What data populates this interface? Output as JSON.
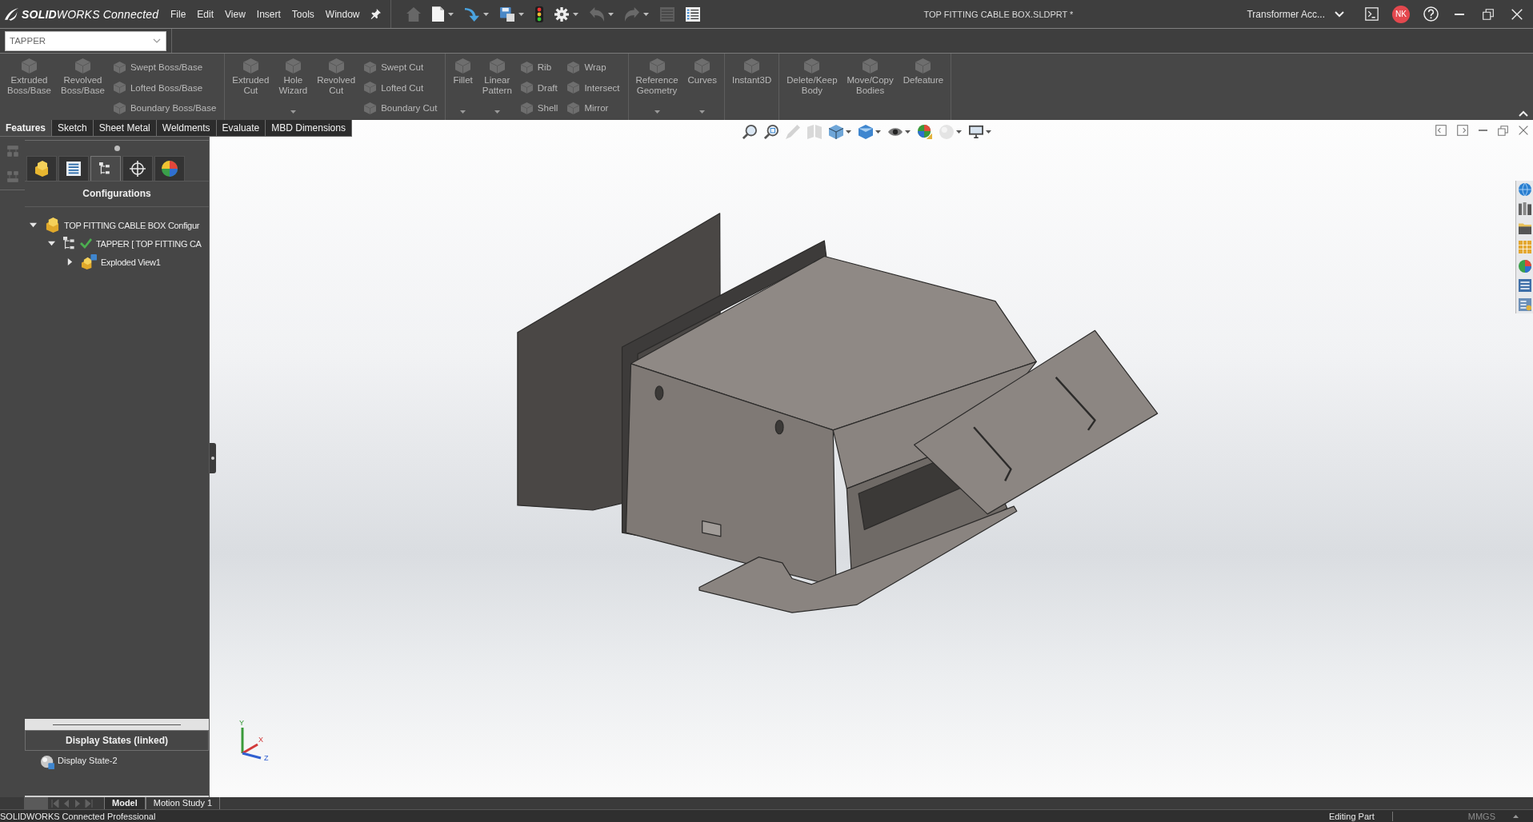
{
  "title_bar": {
    "brand": "**SOLID**WORKS Connected",
    "menu": [
      "File",
      "Edit",
      "View",
      "Insert",
      "Tools",
      "Window"
    ],
    "quick_access": [
      {
        "dropdown": false,
        "disabled": true
      },
      {
        "dropdown": true,
        "disabled": false
      },
      {
        "dropdown": true,
        "disabled": false
      },
      {
        "dropdown": true,
        "disabled": false
      },
      {
        "dropdown": false,
        "disabled": false
      },
      {
        "dropdown": true,
        "disabled": false
      },
      {
        "dropdown": true,
        "disabled": true
      },
      {
        "dropdown": true,
        "disabled": true
      },
      {
        "dropdown": false,
        "disabled": true
      },
      {
        "dropdown": false,
        "disabled": false
      }
    ],
    "document_title": "TOP FITTING CABLE BOX.SLDPRT *",
    "account": "Transformer Acc...",
    "avatar": "NK"
  },
  "configuration_selector": {
    "value": "TAPPER"
  },
  "ribbon": {
    "groups": [
      {
        "items": [
          {
            "kind": "large",
            "label": "Extruded Boss/Base",
            "dropdown": false
          },
          {
            "kind": "large",
            "label": "Revolved Boss/Base",
            "dropdown": false
          },
          {
            "kind": "column",
            "buttons": [
              "Swept Boss/Base",
              "Lofted Boss/Base",
              "Boundary Boss/Base"
            ]
          }
        ]
      },
      {
        "items": [
          {
            "kind": "large",
            "label": "Extruded Cut",
            "dropdown": false
          },
          {
            "kind": "large",
            "label": "Hole Wizard",
            "dropdown": true
          },
          {
            "kind": "large",
            "label": "Revolved Cut",
            "dropdown": false
          },
          {
            "kind": "column",
            "buttons": [
              "Swept Cut",
              "Lofted Cut",
              "Boundary Cut"
            ]
          }
        ]
      },
      {
        "items": [
          {
            "kind": "large",
            "label": "Fillet",
            "dropdown": true
          },
          {
            "kind": "large",
            "label": "Linear Pattern",
            "dropdown": true
          },
          {
            "kind": "column",
            "buttons": [
              "Rib",
              "Draft",
              "Shell"
            ]
          },
          {
            "kind": "column",
            "buttons": [
              "Wrap",
              "Intersect",
              "Mirror"
            ]
          }
        ]
      },
      {
        "items": [
          {
            "kind": "large",
            "label": "Reference Geometry",
            "dropdown": true
          },
          {
            "kind": "large",
            "label": "Curves",
            "dropdown": true
          }
        ]
      },
      {
        "items": [
          {
            "kind": "large",
            "label": "Instant3D",
            "dropdown": false
          }
        ]
      },
      {
        "items": [
          {
            "kind": "large",
            "label": "Delete/Keep Body",
            "dropdown": false
          },
          {
            "kind": "large",
            "label": "Move/Copy Bodies",
            "dropdown": false
          },
          {
            "kind": "large",
            "label": "Defeature",
            "dropdown": false
          }
        ]
      }
    ]
  },
  "command_tabs": [
    {
      "label": "Features",
      "selected": true
    },
    {
      "label": "Sketch",
      "selected": false
    },
    {
      "label": "Sheet Metal",
      "selected": false
    },
    {
      "label": "Weldments",
      "selected": false
    },
    {
      "label": "Evaluate",
      "selected": false
    },
    {
      "label": "MBD Dimensions",
      "selected": false
    }
  ],
  "manager_tabs": [
    {
      "selected": false
    },
    {
      "selected": false
    },
    {
      "selected": true
    },
    {
      "selected": false
    },
    {
      "selected": false
    }
  ],
  "configuration_manager": {
    "title": "Configurations",
    "tree": [
      {
        "kind": "part",
        "label": "TOP FITTING CABLE BOX Configur",
        "expanded": true,
        "active": false,
        "children": [
          {
            "kind": "configuration",
            "label": "TAPPER [ TOP FITTING CA",
            "expanded": true,
            "active": true,
            "children": [
              {
                "kind": "exploded_view",
                "label": "Exploded View1",
                "expanded": false,
                "active": false
              }
            ]
          }
        ]
      }
    ]
  },
  "display_states": {
    "title": "Display States (linked)",
    "items": [
      "Display State-2"
    ]
  },
  "view_toolbar": [
    {
      "dropdown": false,
      "disabled": false
    },
    {
      "dropdown": false,
      "disabled": false
    },
    {
      "dropdown": false,
      "disabled": true
    },
    {
      "dropdown": false,
      "disabled": true
    },
    {
      "dropdown": true,
      "disabled": false
    },
    {
      "dropdown": true,
      "disabled": false
    },
    {
      "dropdown": true,
      "disabled": false
    },
    {
      "dropdown": false,
      "disabled": false
    },
    {
      "dropdown": true,
      "disabled": true
    },
    {
      "dropdown": true,
      "disabled": false
    }
  ],
  "triad": {
    "y": "Y",
    "x": "X",
    "z": "Z"
  },
  "bottom_bar": {
    "nav_disabled": true,
    "tabs": [
      {
        "label": "Model",
        "selected": true
      },
      {
        "label": "Motion Study 1",
        "selected": false
      }
    ]
  },
  "status_bar": {
    "product": "SOLIDWORKS Connected Professional",
    "mode": "Editing Part",
    "units": "MMGS"
  }
}
